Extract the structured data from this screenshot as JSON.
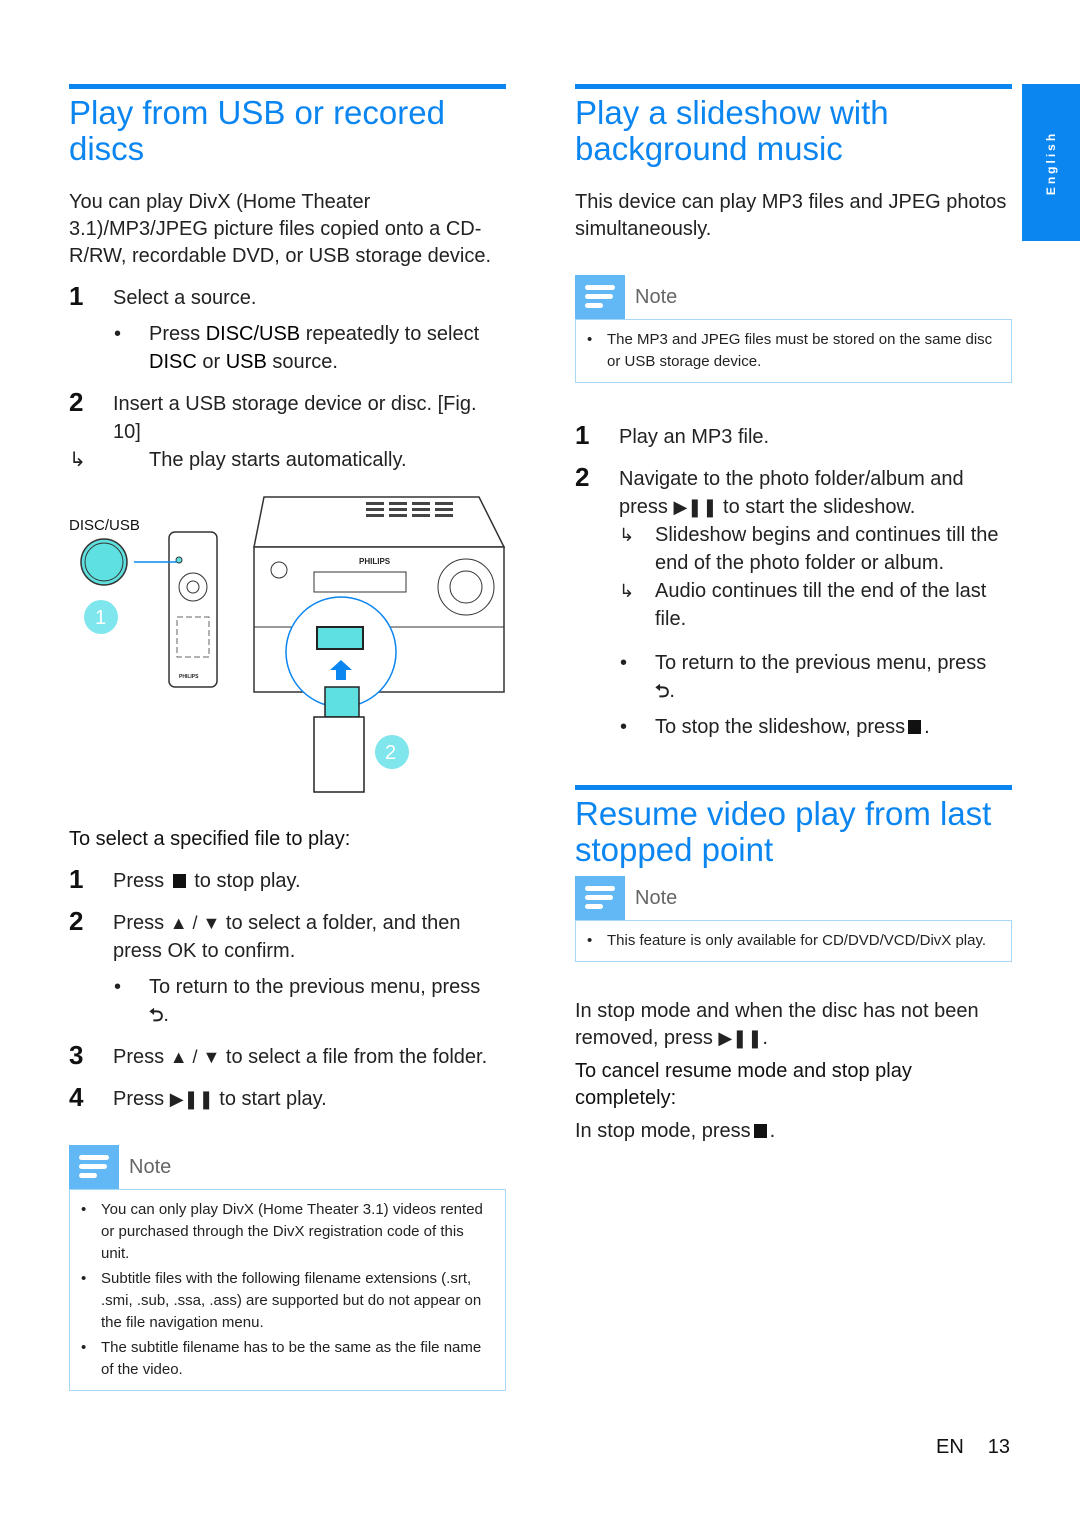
{
  "side_tab": {
    "label": "English"
  },
  "left": {
    "title": "Play from USB or recored discs",
    "intro": "You can play DivX (Home Theater 3.1)/MP3/JPEG picture files copied onto a CD-R/RW, recordable DVD, or USB storage device.",
    "steps": [
      {
        "num": "1",
        "text": "Select a source."
      },
      {
        "num": "2",
        "text": "Insert a USB storage device or disc.",
        "ref": "[Fig. 10]"
      }
    ],
    "step1_bullet": {
      "pre": "Press ",
      "key1": "DISC/USB",
      "mid": " repeatedly to select ",
      "key2": "DISC",
      "or": " or ",
      "key3": "USB",
      "post": " source."
    },
    "step2_result": "The play starts automatically.",
    "figure": {
      "button_label": "DISC/USB",
      "callout_1": "1",
      "callout_2": "2",
      "brand": "PHILIPS",
      "remote_brand": "PHILIPS"
    },
    "sub_heading": "To select a specified file to play:",
    "file_steps": [
      {
        "num": "1",
        "pre": "Press ",
        "post": " to stop play."
      },
      {
        "num": "2",
        "pre": "Press ",
        "post": " to select a folder, and then press OK to confirm."
      },
      {
        "num": "3",
        "pre": "Press ",
        "post": " to select a file from the folder."
      },
      {
        "num": "4",
        "pre": "Press ",
        "post": " to start play."
      }
    ],
    "file_step2_bullet": "To return to the previous menu, press",
    "note": {
      "label": "Note",
      "items": [
        "You can only play DivX (Home Theater 3.1) videos rented or purchased through the DivX registration code of this unit.",
        "Subtitle files with the following filename extensions (.srt, .smi, .sub, .ssa, .ass) are supported but do not appear on the file navigation menu.",
        "The subtitle filename has to be the same as the file name of the video."
      ]
    }
  },
  "right": {
    "title": "Play a slideshow with background music",
    "intro": "This device can play MP3 files and JPEG photos simultaneously.",
    "note": {
      "label": "Note",
      "items": [
        "The MP3 and JPEG files must be stored on the same disc or USB storage device."
      ]
    },
    "steps": [
      {
        "num": "1",
        "text": "Play an MP3 file."
      },
      {
        "num": "2",
        "pre": "Navigate to the photo folder/album and press ",
        "post": " to start the slideshow."
      }
    ],
    "results": [
      "Slideshow begins and continues till the end of the photo folder or album.",
      "Audio continues till the end of the last file."
    ],
    "bullets": [
      {
        "text": "To return to the previous menu, press"
      },
      {
        "text": "To stop the slideshow, press"
      }
    ],
    "resume": {
      "title": "Resume video play from last stopped point",
      "note": {
        "label": "Note",
        "items": [
          "This feature is only available for CD/DVD/VCD/DivX play."
        ]
      },
      "p1": "In stop mode and when the disc has not been removed, press",
      "sub_heading": "To cancel resume mode and stop play completely:",
      "p2": "In stop mode, press"
    }
  },
  "symbols": {
    "up_down": "▲ / ▼",
    "play_pause": "▶❚❚",
    "back": "⮌",
    "result_arrow": "↳",
    "bullet": "•"
  },
  "footer": {
    "lang": "EN",
    "page": "13"
  }
}
